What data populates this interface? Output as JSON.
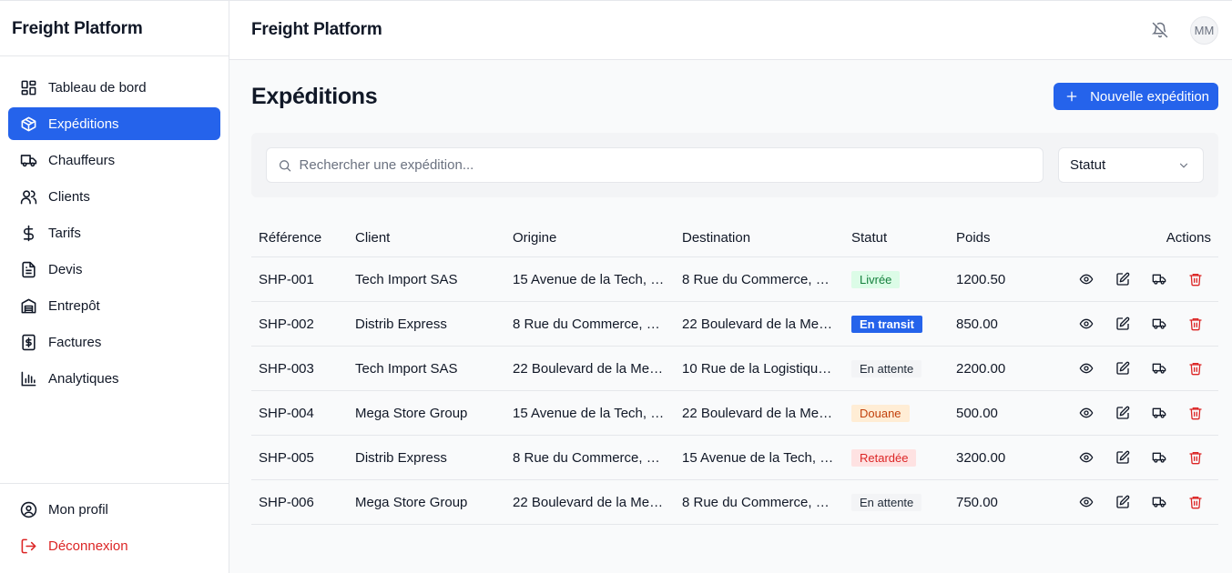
{
  "app": {
    "brand": "Freight Platform"
  },
  "sidebar": {
    "items": [
      {
        "label": "Tableau de bord",
        "icon": "dashboard-icon"
      },
      {
        "label": "Expéditions",
        "icon": "package-icon",
        "active": true
      },
      {
        "label": "Chauffeurs",
        "icon": "truck-icon"
      },
      {
        "label": "Clients",
        "icon": "users-icon"
      },
      {
        "label": "Tarifs",
        "icon": "dollar-icon"
      },
      {
        "label": "Devis",
        "icon": "file-text-icon"
      },
      {
        "label": "Entrepôt",
        "icon": "warehouse-icon"
      },
      {
        "label": "Factures",
        "icon": "receipt-icon"
      },
      {
        "label": "Analytiques",
        "icon": "bar-chart-icon"
      }
    ],
    "bottom": [
      {
        "label": "Mon profil",
        "icon": "user-circle-icon"
      },
      {
        "label": "Déconnexion",
        "icon": "logout-icon"
      }
    ]
  },
  "header": {
    "title": "Freight Platform",
    "avatar_initials": "MM"
  },
  "page": {
    "title": "Expéditions",
    "new_button": "Nouvelle expédition",
    "search_placeholder": "Rechercher une expédition...",
    "status_filter": "Statut"
  },
  "table": {
    "columns": [
      "Référence",
      "Client",
      "Origine",
      "Destination",
      "Statut",
      "Poids",
      "Actions"
    ],
    "rows": [
      {
        "ref": "SHP-001",
        "client": "Tech Import SAS",
        "origin": "15 Avenue de la Tech, …",
        "destination": "8 Rue du Commerce, 3…",
        "status": "Livrée",
        "status_kind": "delivered",
        "weight": "1200.50"
      },
      {
        "ref": "SHP-002",
        "client": "Distrib Express",
        "origin": "8 Rue du Commerce, 3…",
        "destination": "22 Boulevard de la Mer…",
        "status": "En transit",
        "status_kind": "transit",
        "weight": "850.00"
      },
      {
        "ref": "SHP-003",
        "client": "Tech Import SAS",
        "origin": "22 Boulevard de la Mer…",
        "destination": "10 Rue de la Logistiqu…",
        "status": "En attente",
        "status_kind": "pending",
        "weight": "2200.00"
      },
      {
        "ref": "SHP-004",
        "client": "Mega Store Group",
        "origin": "15 Avenue de la Tech, …",
        "destination": "22 Boulevard de la Mer…",
        "status": "Douane",
        "status_kind": "customs",
        "weight": "500.00"
      },
      {
        "ref": "SHP-005",
        "client": "Distrib Express",
        "origin": "8 Rue du Commerce, 3…",
        "destination": "15 Avenue de la Tech, …",
        "status": "Retardée",
        "status_kind": "delayed",
        "weight": "3200.00"
      },
      {
        "ref": "SHP-006",
        "client": "Mega Store Group",
        "origin": "22 Boulevard de la Mer…",
        "destination": "8 Rue du Commerce, 3…",
        "status": "En attente",
        "status_kind": "pending",
        "weight": "750.00"
      }
    ]
  },
  "colors": {
    "accent": "#2563eb",
    "danger": "#dc2626"
  }
}
